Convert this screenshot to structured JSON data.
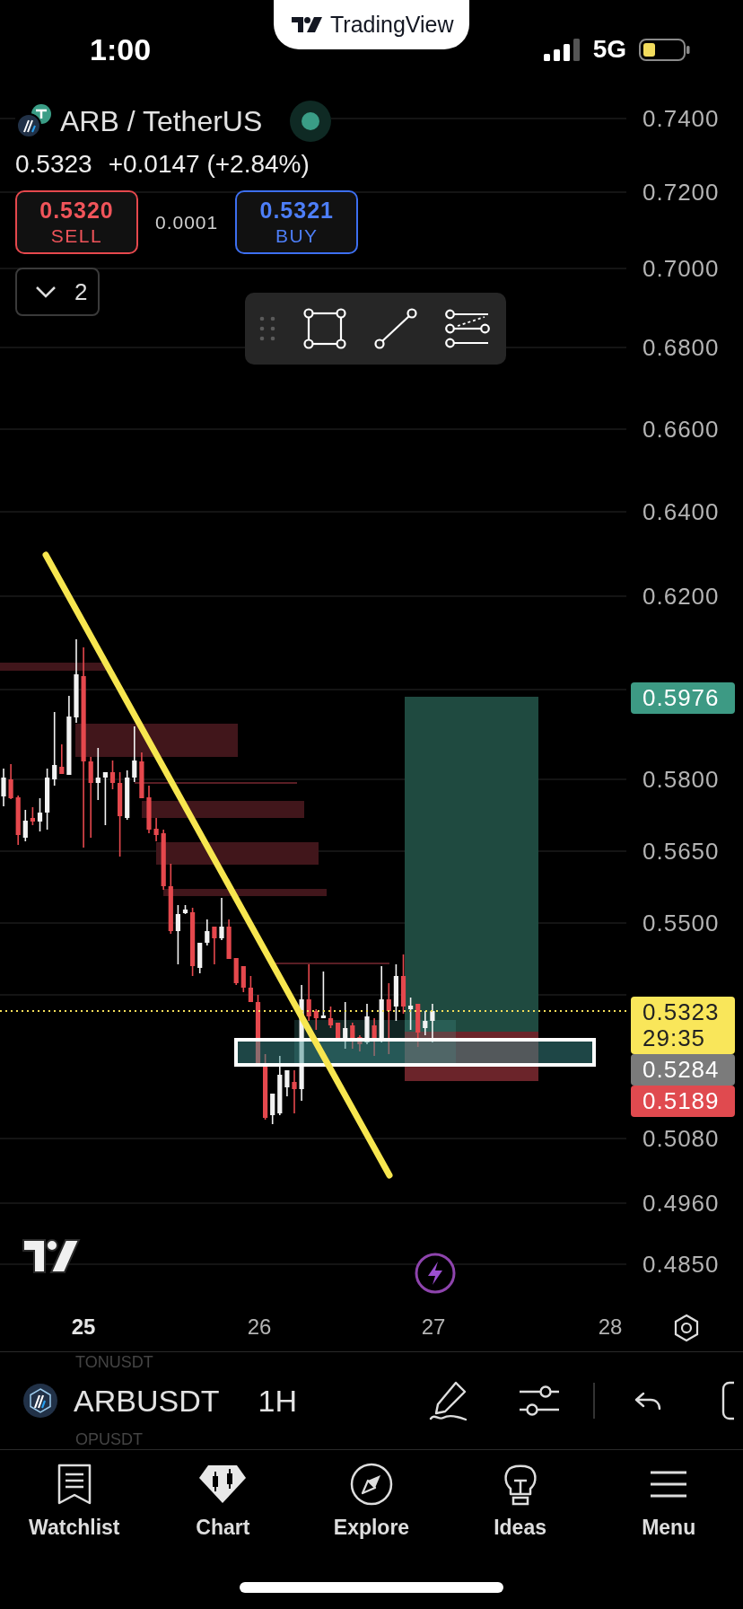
{
  "status_bar": {
    "time": "1:00",
    "network": "5G"
  },
  "banner": {
    "name": "TradingView"
  },
  "header": {
    "title": "ARB / TetherUS",
    "live": true,
    "last_price": "0.5323",
    "change": "+0.0147 (+2.84%)",
    "orders": [
      {
        "kind": "sell",
        "price": "0.5320",
        "label": "SELL"
      },
      {
        "kind": "buy",
        "price": "0.5321",
        "label": "BUY"
      }
    ],
    "spread": "0.0001",
    "collapse_count": "2"
  },
  "drawing_toolbar": {
    "tools": [
      {
        "kind": "rectangle"
      },
      {
        "kind": "line"
      },
      {
        "kind": "fib"
      }
    ]
  },
  "chart": {
    "price_axis": [
      "0.7400",
      "0.7200",
      "0.7000",
      "0.6800",
      "0.6600",
      "0.6400",
      "0.6200",
      "0.5800",
      "0.5650",
      "0.5500",
      "0.5080",
      "0.4960",
      "0.4850"
    ],
    "price_tags": [
      {
        "kind": "target",
        "price": "0.5976",
        "color": "#3d9a84"
      },
      {
        "kind": "current",
        "price": "0.5323",
        "countdown": "29:35",
        "color": "#f9e65a"
      },
      {
        "kind": "entry",
        "price": "0.5284",
        "color": "#7b7b7b"
      },
      {
        "kind": "stop",
        "price": "0.5189",
        "color": "#e04a4f"
      }
    ],
    "time_axis": [
      {
        "label": "25",
        "emphasized": true
      },
      {
        "label": "26",
        "emphasized": false
      },
      {
        "label": "27",
        "emphasized": false
      },
      {
        "label": "28",
        "emphasized": false
      }
    ]
  },
  "symbol_bar": {
    "previous_symbol": "TONUSDT",
    "symbol": "ARBUSDT",
    "interval": "1H",
    "next_symbol": "OPUSDT"
  },
  "nav": [
    {
      "kind": "watchlist",
      "label": "Watchlist"
    },
    {
      "kind": "chart",
      "label": "Chart"
    },
    {
      "kind": "explore",
      "label": "Explore"
    },
    {
      "kind": "ideas",
      "label": "Ideas"
    },
    {
      "kind": "menu",
      "label": "Menu"
    }
  ]
}
